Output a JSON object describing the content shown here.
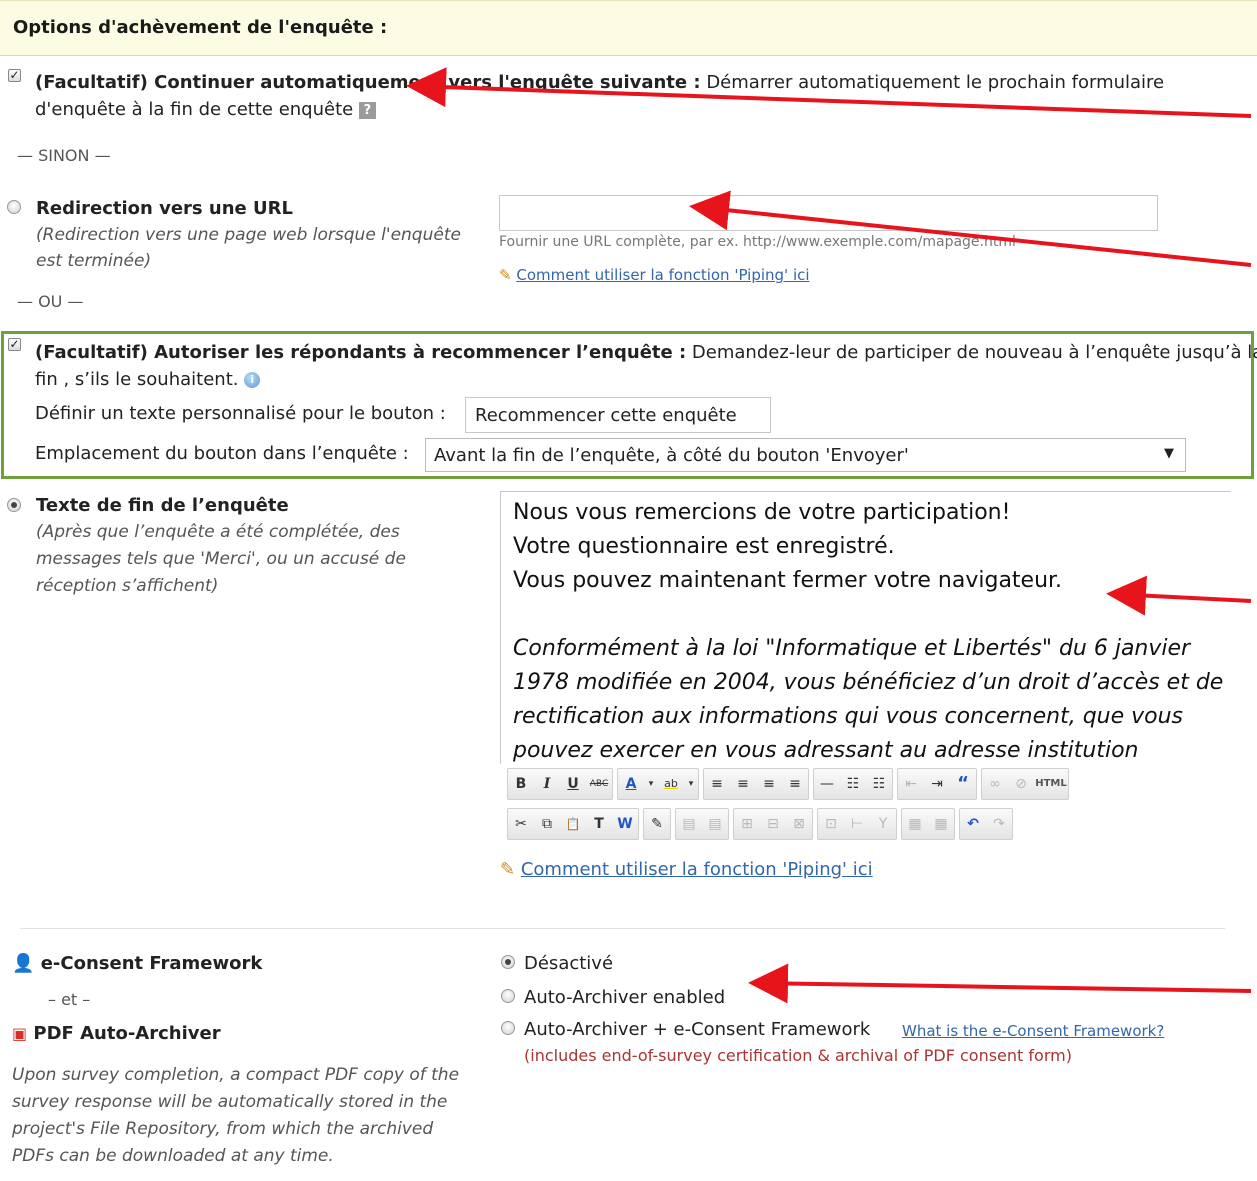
{
  "header": {
    "title": "Options d'achèvement de l'enquête :"
  },
  "auto_continue": {
    "checked": true,
    "label_bold": "(Facultatif) Continuer automatiquement vers l'enquête suivante :",
    "label_rest": " Démarrer automatiquement le prochain formulaire",
    "label_line2": "d'enquête à la fin de cette enquête",
    "help_icon": "?"
  },
  "sep_sinon": "— SINON —",
  "redirect": {
    "title": "Redirection vers une URL",
    "desc_line1": "(Redirection vers une page web lorsque l'enquête",
    "desc_line2": "est terminée)",
    "url_value": "",
    "hint": "Fournir une URL complète, par ex. http://www.exemple.com/mapage.html",
    "piping_link": "Comment utiliser la fonction 'Piping' ici"
  },
  "sep_ou": "— OU —",
  "restart": {
    "checked": true,
    "label_bold": "(Facultatif) Autoriser les répondants à recommencer l’enquête :",
    "label_rest": " Demandez-leur de participer de nouveau à l’enquête jusqu’à la",
    "label_line2": "fin , s’ils le souhaitent.",
    "custom_text_label": "Définir un texte personnalisé pour le bouton :",
    "custom_text_value": "Recommencer cette enquête",
    "placement_label": "Emplacement du bouton dans l’enquête :",
    "placement_value": "Avant la fin de l’enquête, à côté du bouton 'Envoyer'"
  },
  "end_text": {
    "title": "Texte de fin de l’enquête",
    "desc_line1": "(Après que l’enquête a été complétée, des",
    "desc_line2": "messages tels que 'Merci', ou un accusé de",
    "desc_line3": "réception s’affichent)",
    "editor_lines": [
      "Nous vous remercions de votre participation!",
      "Votre questionnaire est enregistré.",
      "Vous pouvez maintenant fermer votre navigateur."
    ],
    "editor_italic_lines": [
      "Conformément à la loi \"Informatique et Libertés\" du 6 janvier",
      "1978 modifiée en 2004, vous bénéficiez d’un droit d’accès et de",
      "rectification aux informations qui vous concernent, que vous",
      "pouvez exercer en vous adressant au adresse institution"
    ],
    "piping_link": "Comment utiliser la fonction 'Piping' ici"
  },
  "toolbar": {
    "row1": [
      "B",
      "I",
      "U",
      "ABC",
      "A",
      "ab",
      "≡",
      "≡",
      "≡",
      "≡",
      "—",
      "☷",
      "☷",
      "⇤",
      "⇥",
      "“",
      "∞",
      "⊘",
      "HTML"
    ],
    "row2": [
      "✂",
      "⧉",
      "📋",
      "T",
      "W",
      "✎",
      "▤",
      "▤",
      "⊞",
      "⊟",
      "⊠",
      "⊡",
      "⊢",
      "Y",
      "▦",
      "▦",
      "↶",
      "↷"
    ]
  },
  "econsent": {
    "title": "e-Consent Framework",
    "and": "– et –",
    "archiver_title": "PDF Auto-Archiver",
    "desc_line1": "Upon survey completion, a compact PDF copy of the",
    "desc_line2": "survey response will be automatically stored in the",
    "desc_line3": "project's File Repository, from which the archived",
    "desc_line4": "PDFs can be downloaded at any time.",
    "options": [
      {
        "label": "Désactivé",
        "selected": true
      },
      {
        "label": "Auto-Archiver enabled",
        "selected": false
      },
      {
        "label": "Auto-Archiver + e-Consent Framework",
        "selected": false
      }
    ],
    "what_link": "What is the e-Consent Framework?",
    "note": "(includes end-of-survey certification & archival of PDF consent form)"
  },
  "colors": {
    "header_bg": "#fcfbe3",
    "green_frame": "#6ea13c",
    "arrow": "#e8141c",
    "link": "#3366aa"
  }
}
